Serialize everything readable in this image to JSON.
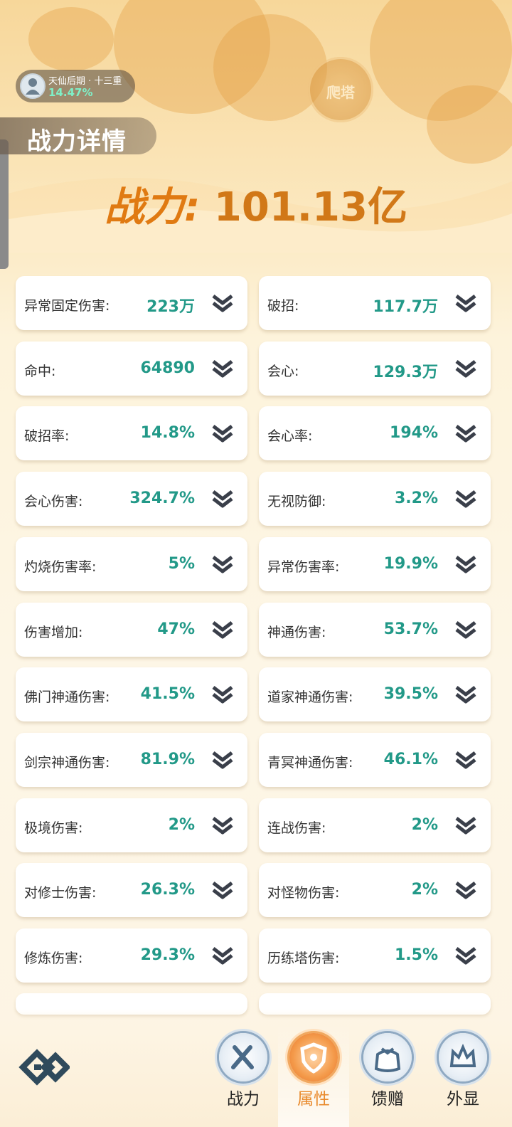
{
  "level_badge": {
    "title": "天仙后期 · 十三重",
    "progress": "14.47%"
  },
  "tower_button": {
    "label": "爬塔"
  },
  "page_title": "战力详情",
  "power": {
    "label": "战力:",
    "value": "101.13亿"
  },
  "stats": [
    {
      "label": "异常固定伤害:",
      "value": "223万"
    },
    {
      "label": "破招:",
      "value": "117.7万"
    },
    {
      "label": "命中:",
      "value": "64890"
    },
    {
      "label": "会心:",
      "value": "129.3万"
    },
    {
      "label": "破招率:",
      "value": "14.8%"
    },
    {
      "label": "会心率:",
      "value": "194%"
    },
    {
      "label": "会心伤害:",
      "value": "324.7%"
    },
    {
      "label": "无视防御:",
      "value": "3.2%"
    },
    {
      "label": "灼烧伤害率:",
      "value": "5%"
    },
    {
      "label": "异常伤害率:",
      "value": "19.9%"
    },
    {
      "label": "伤害增加:",
      "value": "47%"
    },
    {
      "label": "神通伤害:",
      "value": "53.7%"
    },
    {
      "label": "佛门神通伤害:",
      "value": "41.5%"
    },
    {
      "label": "道家神通伤害:",
      "value": "39.5%"
    },
    {
      "label": "剑宗神通伤害:",
      "value": "81.9%"
    },
    {
      "label": "青冥神通伤害:",
      "value": "46.1%"
    },
    {
      "label": "极境伤害:",
      "value": "2%"
    },
    {
      "label": "连战伤害:",
      "value": "2%"
    },
    {
      "label": "对修士伤害:",
      "value": "26.3%"
    },
    {
      "label": "对怪物伤害:",
      "value": "2%"
    },
    {
      "label": "修炼伤害:",
      "value": "29.3%"
    },
    {
      "label": "历练塔伤害:",
      "value": "1.5%"
    }
  ],
  "nav": {
    "tabs": [
      {
        "label": "战力",
        "icon": "sword-icon"
      },
      {
        "label": "属性",
        "icon": "shield-icon",
        "active": true
      },
      {
        "label": "馈赠",
        "icon": "gift-bag-icon"
      },
      {
        "label": "外显",
        "icon": "crown-icon"
      }
    ]
  }
}
